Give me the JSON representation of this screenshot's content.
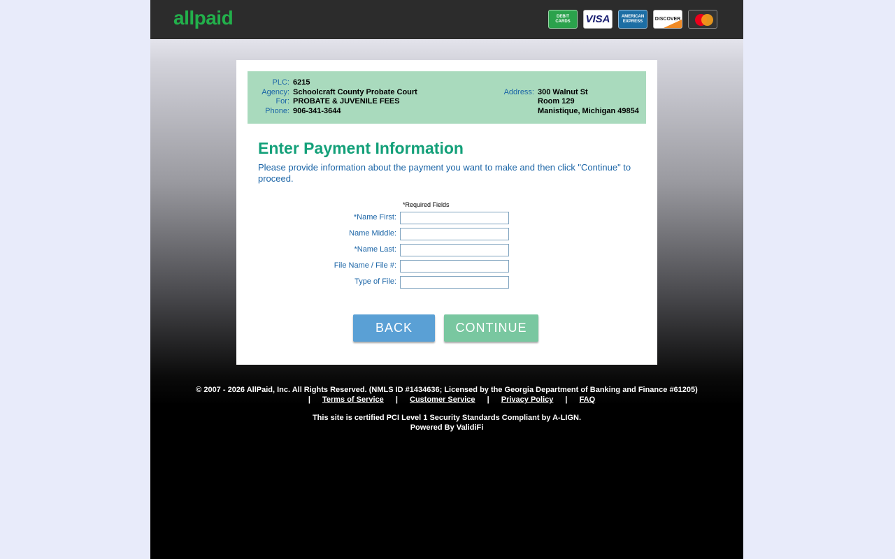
{
  "header": {
    "logo_text": "allpaid",
    "brand_color": "#22b04b",
    "cards": {
      "debit": "DEBIT CARDS",
      "visa": "VISA",
      "amex": "AMERICAN EXPRESS",
      "discover": "DISCOVER",
      "mastercard_icon": "mastercard-icon"
    }
  },
  "info": {
    "plc_label": "PLC:",
    "plc_value": "6215",
    "agency_label": "Agency:",
    "agency_value": "Schoolcraft County Probate Court",
    "for_label": "For:",
    "for_value": "PROBATE & JUVENILE FEES",
    "phone_label": "Phone:",
    "phone_value": "906-341-3644",
    "address_label": "Address:",
    "address_line1": "300 Walnut St",
    "address_line2": "Room 129",
    "address_line3": "Manistique, Michigan 49854"
  },
  "main": {
    "heading": "Enter Payment Information",
    "instructions": "Please provide information about the payment you want to make and then click \"Continue\" to proceed.",
    "required_note": "*Required Fields"
  },
  "form": {
    "fields": [
      {
        "label": "*Name First:",
        "value": ""
      },
      {
        "label": "Name Middle:",
        "value": ""
      },
      {
        "label": "*Name Last:",
        "value": ""
      },
      {
        "label": "File Name / File #:",
        "value": ""
      },
      {
        "label": "Type of File:",
        "value": ""
      }
    ],
    "back_label": "BACK",
    "continue_label": "CONTINUE"
  },
  "footer": {
    "copyright": "© 2007 - 2026 AllPaid, Inc. All Rights Reserved. (NMLS ID #1434636; Licensed by the Georgia Department of Banking and Finance #61205)",
    "separator": "|",
    "links": [
      "Terms of Service",
      "Customer Service",
      "Privacy Policy",
      "FAQ"
    ],
    "pci": "This site is certified PCI Level 1 Security Standards Compliant by A-LIGN.",
    "powered": "Powered By ValidiFi"
  }
}
